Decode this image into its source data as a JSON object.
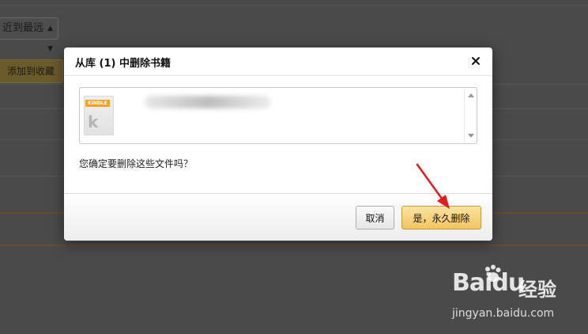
{
  "background": {
    "sort_label": "近到最远",
    "add_button_label": "添加到收藏"
  },
  "dialog": {
    "title": "从库 (1) 中删除书籍",
    "file_item": {
      "badge": "KINDLE",
      "thumb_letter": "k"
    },
    "question": "您确定要删除这些文件吗？",
    "cancel_label": "取消",
    "confirm_label": "是，永久删除"
  },
  "watermark": {
    "logo_text": "Baidu",
    "product": "经验",
    "url": "jingyan.baidu.com"
  },
  "colors": {
    "overlay": "#4a4a4a",
    "confirm_button": "#f2c45d",
    "annotation_arrow": "#e21b1b",
    "kindle_badge": "#f3a321"
  }
}
